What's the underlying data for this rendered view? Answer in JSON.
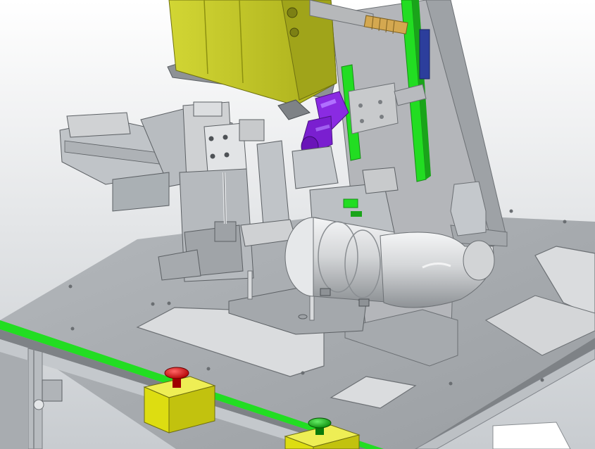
{
  "scene": {
    "kind": "cad-render",
    "background_top": "#ffffff",
    "background_bottom": "#c8ccd0"
  },
  "colors": {
    "table_plate": "#a6aaae",
    "table_edge": "#7e8286",
    "frame_aluminum": "#c4c8cc",
    "trim_green": "#22dd22",
    "housing_yellow_green": "#c2c621",
    "button_box_yellow": "#dddd11",
    "stop_button_red": "#dd1111",
    "start_button_green": "#11bb11",
    "camera_purple": "#8a2be2",
    "duct_silver": "#d6d8da",
    "bracket_grey": "#b4b6ba",
    "slot_inner": "#dadcde"
  },
  "components": [
    {
      "id": "housing",
      "icon": "motor-housing-icon"
    },
    {
      "id": "vertical-plate",
      "icon": "mounting-plate-icon"
    },
    {
      "id": "linear-rail",
      "icon": "linear-guide-icon"
    },
    {
      "id": "camera",
      "icon": "camera-icon"
    },
    {
      "id": "gripper-cylinder",
      "icon": "pneumatic-cylinder-icon"
    },
    {
      "id": "duct-elbow",
      "icon": "duct-elbow-icon"
    },
    {
      "id": "emergency-stop",
      "icon": "stop-button-icon"
    },
    {
      "id": "start-button",
      "icon": "start-button-icon"
    },
    {
      "id": "table",
      "icon": "workbench-icon"
    }
  ]
}
